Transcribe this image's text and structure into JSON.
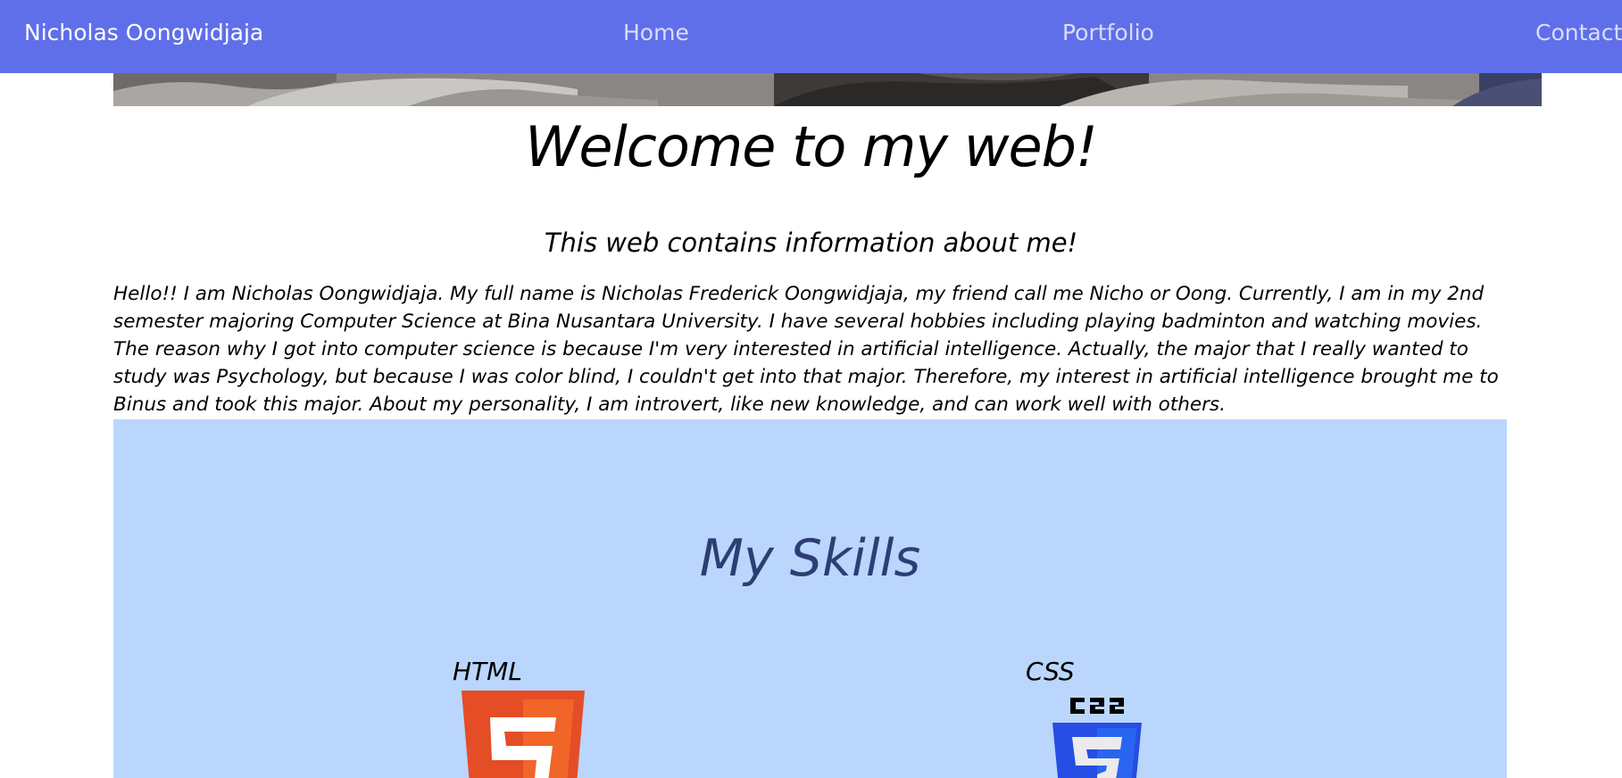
{
  "navbar": {
    "brand": "Nicholas Oongwidjaja",
    "links": [
      {
        "label": "Home"
      },
      {
        "label": "Portfolio"
      },
      {
        "label": "Contact"
      }
    ],
    "background_color": "#5f6fea"
  },
  "hero": {
    "title": "Welcome to my web!",
    "subtitle": "This web contains information about me!"
  },
  "intro": {
    "text": "Hello!! I am Nicholas Oongwidjaja. My full name is Nicholas Frederick Oongwidjaja, my friend call me Nicho or Oong. Currently, I am in my 2nd semester majoring Computer Science at Bina Nusantara University. I have several hobbies including playing badminton and watching movies. The reason why I got into computer science is because I'm very interested in artificial intelligence. Actually, the major that I really wanted to study was Psychology, but because I was color blind, I couldn't get into that major. Therefore, my interest in artificial intelligence brought me to Binus and took this major. About my personality, I am introvert, like new knowledge, and can work well with others."
  },
  "skills": {
    "title": "My Skills",
    "background_color": "#bad6fd",
    "items": [
      {
        "label": "HTML",
        "icon": "html5-icon",
        "color": "#e44d26"
      },
      {
        "label": "CSS",
        "icon": "css3-icon",
        "color": "#264de4"
      }
    ]
  }
}
